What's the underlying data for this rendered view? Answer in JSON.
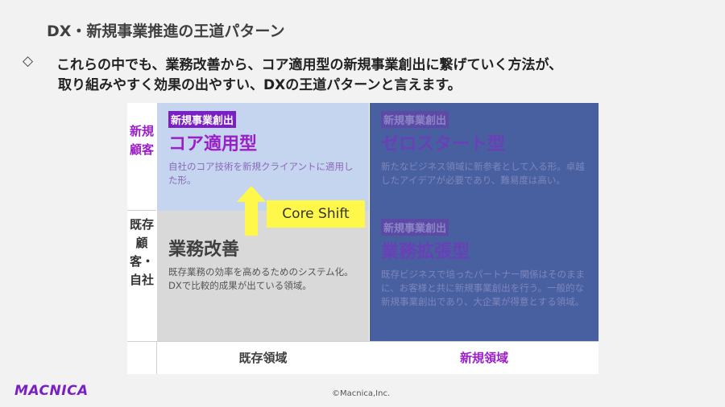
{
  "header": {
    "title": "DX・新規事業推進の王道パターン",
    "bullet": "◇",
    "subtitle_line1": "これらの中でも、業務改善から、コア適用型の新規事業創出に繋げていく方法が、",
    "subtitle_line2": "取り組みやすく効果の出やすい、DXの王道パターンと言えます。"
  },
  "matrix": {
    "row_new": "新規顧客",
    "row_existing": "既存顧客・自社",
    "col_existing": "既存領域",
    "col_new": "新規領域",
    "cells": {
      "top_left": {
        "tag": "新規事業創出",
        "name": "コア適用型",
        "description": "自社のコア技術を新規クライアントに適用した形。"
      },
      "top_right": {
        "tag": "新規事業創出",
        "name": "ゼロスタート型",
        "description": "新たなビジネス領域に新参者として入る形。卓越したアイデアが必要であり、難易度は高い。"
      },
      "bottom_left": {
        "name": "業務改善",
        "description": "既存業務の効率を高めるためのシステム化。DXで比較的成果が出ている領域。"
      },
      "bottom_right": {
        "tag": "新規事業創出",
        "name": "業務拡張型",
        "description": "既存ビジネスで培ったパートナー関係はそのままに、お客様と共に新規事業創出を行う。一般的な新規事業創出であり、大企業が得意とする領域。"
      }
    },
    "shift_label": "Core Shift"
  },
  "footer": {
    "logo": "MACNICA",
    "copyright": "©Macnica,Inc."
  },
  "colors": {
    "accent_purple": "#9b1fc9",
    "cell_light_blue": "#c5d4ef",
    "cell_dark_blue": "#4960a0",
    "cell_gray": "#d9d9d9",
    "shift_yellow": "#fff84a"
  }
}
